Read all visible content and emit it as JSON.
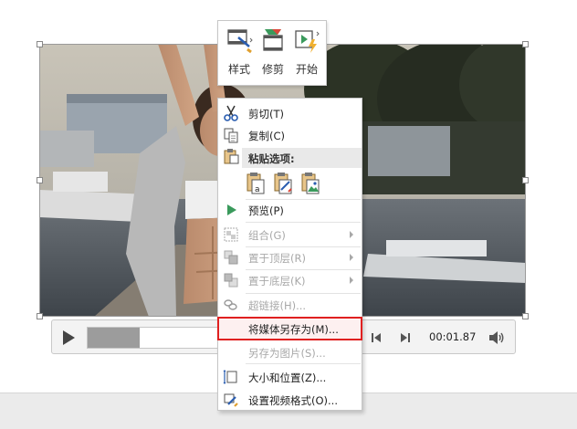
{
  "mini_toolbar": {
    "buttons": [
      {
        "label": "样式",
        "icon": "video-style-icon"
      },
      {
        "label": "修剪",
        "icon": "trim-video-icon"
      },
      {
        "label": "开始",
        "icon": "start-play-icon"
      }
    ]
  },
  "playback": {
    "progress": 0.4,
    "time": "00:01.87",
    "play_icon": "play-icon",
    "back_icon": "step-back-icon",
    "forward_icon": "step-forward-icon",
    "volume_icon": "volume-icon"
  },
  "context_menu": {
    "items": [
      {
        "label": "剪切(T)",
        "icon": "scissors-icon",
        "enabled": true
      },
      {
        "label": "复制(C)",
        "icon": "copy-icon",
        "enabled": true
      },
      {
        "label": "粘贴选项:",
        "icon": "clipboard-icon",
        "header": true
      },
      {
        "label": "预览(P)",
        "icon": "preview-play-icon",
        "enabled": true
      },
      {
        "label": "组合(G)",
        "icon": "group-icon",
        "enabled": false,
        "submenu": true
      },
      {
        "label": "置于顶层(R)",
        "icon": "bring-front-icon",
        "enabled": false,
        "submenu": true
      },
      {
        "label": "置于底层(K)",
        "icon": "send-back-icon",
        "enabled": false,
        "submenu": true
      },
      {
        "label": "超链接(H)...",
        "icon": "hyperlink-icon",
        "enabled": false
      },
      {
        "label": "将媒体另存为(M)...",
        "icon": "",
        "enabled": true,
        "highlighted": true
      },
      {
        "label": "另存为图片(S)...",
        "icon": "",
        "enabled": false
      },
      {
        "label": "大小和位置(Z)...",
        "icon": "size-position-icon",
        "enabled": true
      },
      {
        "label": "设置视频格式(O)...",
        "icon": "format-video-icon",
        "enabled": true
      }
    ],
    "paste_options": [
      "paste-keep-source-icon",
      "paste-picture-format-icon",
      "paste-picture-icon"
    ]
  },
  "colors": {
    "highlight_border": "#e02020",
    "preview_green": "#3a9a5c",
    "scissors_blue": "#2a5db0"
  }
}
